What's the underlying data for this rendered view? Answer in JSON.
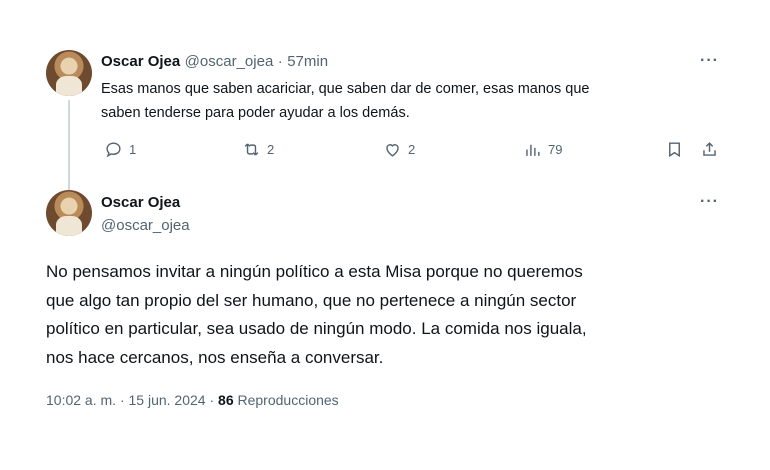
{
  "tweet1": {
    "name": "Oscar Ojea",
    "handle": "@oscar_ojea",
    "separator": "·",
    "time": "57min",
    "text_line1": "Esas manos que saben acariciar, que saben dar de comer, esas manos que",
    "text_line2": "saben tenderse para poder ayudar a los demás.",
    "replies": "1",
    "retweets": "2",
    "likes": "2",
    "views": "79"
  },
  "tweet2": {
    "name": "Oscar Ojea",
    "handle": "@oscar_ojea",
    "text_lines": [
      "No pensamos invitar a ningún político a esta Misa porque no queremos",
      "que algo tan propio del ser humano, que no pertenece a ningún sector",
      "político en particular, sea usado de ningún modo. La comida nos iguala,",
      "nos hace cercanos, nos enseña a conversar."
    ],
    "time": "10:02 a. m.",
    "dot": "·",
    "date": "15 jun. 2024",
    "views_count": "86",
    "views_label": "Reproducciones"
  },
  "more_label": "···",
  "icons": [
    "reply-icon",
    "retweet-icon",
    "like-icon",
    "views-icon",
    "bookmark-icon",
    "share-icon",
    "more-icon"
  ]
}
